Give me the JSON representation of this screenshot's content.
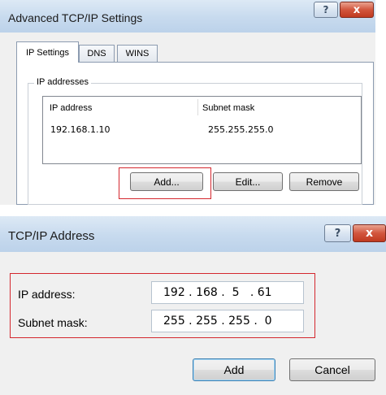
{
  "dialog1": {
    "title": "Advanced TCP/IP Settings",
    "help_glyph": "?",
    "close_glyph": "x",
    "tabs": [
      {
        "label": "IP Settings",
        "active": true
      },
      {
        "label": "DNS",
        "active": false
      },
      {
        "label": "WINS",
        "active": false
      }
    ],
    "group_label": "IP addresses",
    "columns": [
      "IP address",
      "Subnet mask"
    ],
    "rows": [
      {
        "ip": "192.168.1.10",
        "mask": "255.255.255.0"
      }
    ],
    "buttons": {
      "add": "Add...",
      "edit": "Edit...",
      "remove": "Remove"
    }
  },
  "dialog2": {
    "title": "TCP/IP Address",
    "help_glyph": "?",
    "close_glyph": "x",
    "ip_label": "IP address:",
    "ip_value": "192 . 168 .  5   . 61",
    "mask_label": "Subnet mask:",
    "mask_value": "255 . 255 . 255 .  0",
    "buttons": {
      "add": "Add",
      "cancel": "Cancel"
    }
  },
  "colors": {
    "highlight_box": "#d4272e",
    "close_button": "#c8452c",
    "titlebar": "#c7daee"
  }
}
